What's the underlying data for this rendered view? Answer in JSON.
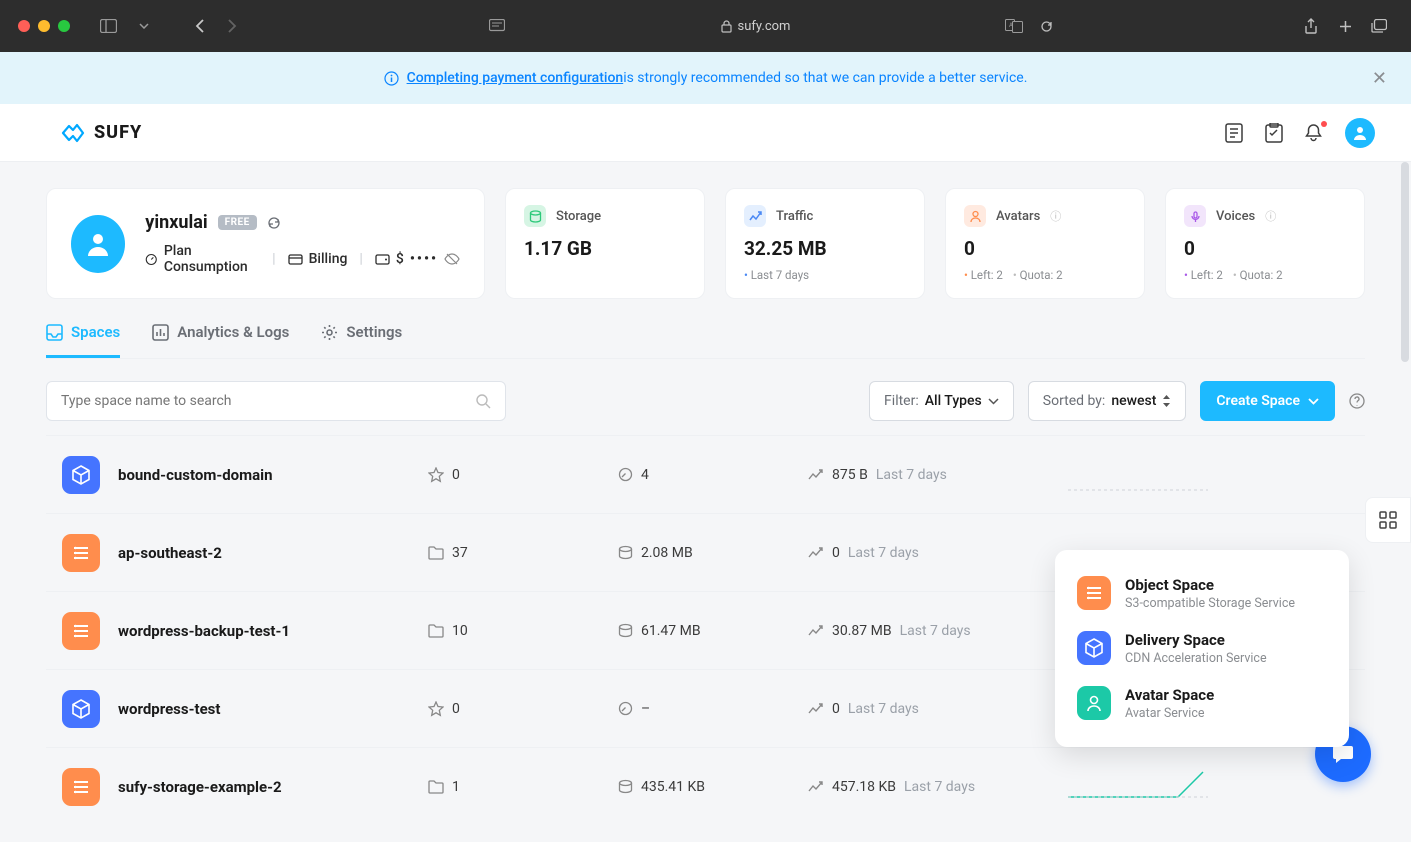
{
  "browser": {
    "url_host": "sufy.com"
  },
  "banner": {
    "link_text": "Completing payment configuration",
    "rest_text": " is strongly recommended so that we can provide a better service."
  },
  "logo_text": "SUFY",
  "user": {
    "name": "yinxulai",
    "badge": "FREE",
    "meta_plan": "Plan Consumption",
    "meta_billing": "Billing",
    "meta_currency": "$",
    "meta_masked": "••••"
  },
  "stats": {
    "storage": {
      "label": "Storage",
      "value": "1.17 GB"
    },
    "traffic": {
      "label": "Traffic",
      "value": "32.25 MB",
      "sub1": "Last 7 days"
    },
    "avatars": {
      "label": "Avatars",
      "value": "0",
      "sub1": "Left: 2",
      "sub2": "Quota: 2"
    },
    "voices": {
      "label": "Voices",
      "value": "0",
      "sub1": "Left: 2",
      "sub2": "Quota: 2"
    }
  },
  "tabs": {
    "spaces": "Spaces",
    "analytics": "Analytics & Logs",
    "settings": "Settings"
  },
  "toolbar": {
    "search_placeholder": "Type space name to search",
    "filter_label": "Filter:",
    "filter_value": "All Types",
    "sort_label": "Sorted by:",
    "sort_value": "newest",
    "create_label": "Create Space"
  },
  "dropdown": {
    "items": [
      {
        "title": "Object Space",
        "sub": "S3-compatible Storage Service"
      },
      {
        "title": "Delivery Space",
        "sub": "CDN Acceleration Service"
      },
      {
        "title": "Avatar Space",
        "sub": "Avatar Service"
      }
    ]
  },
  "spaces": [
    {
      "type": "delivery",
      "name": "bound-custom-domain",
      "files_icon": "star",
      "files": "0",
      "size_icon": "gauge",
      "size": "4",
      "traffic": "875 B",
      "period": "Last 7 days"
    },
    {
      "type": "object",
      "name": "ap-southeast-2",
      "files_icon": "folder",
      "files": "37",
      "size_icon": "disk",
      "size": "2.08 MB",
      "traffic": "0",
      "period": "Last 7 days"
    },
    {
      "type": "object",
      "name": "wordpress-backup-test-1",
      "files_icon": "folder",
      "files": "10",
      "size_icon": "disk",
      "size": "61.47 MB",
      "traffic": "30.87 MB",
      "period": "Last 7 days"
    },
    {
      "type": "delivery",
      "name": "wordpress-test",
      "files_icon": "star",
      "files": "0",
      "size_icon": "gauge",
      "size": "–",
      "traffic": "0",
      "period": "Last 7 days"
    },
    {
      "type": "object",
      "name": "sufy-storage-example-2",
      "files_icon": "folder",
      "files": "1",
      "size_icon": "disk",
      "size": "435.41 KB",
      "traffic": "457.18 KB",
      "period": "Last 7 days"
    }
  ]
}
